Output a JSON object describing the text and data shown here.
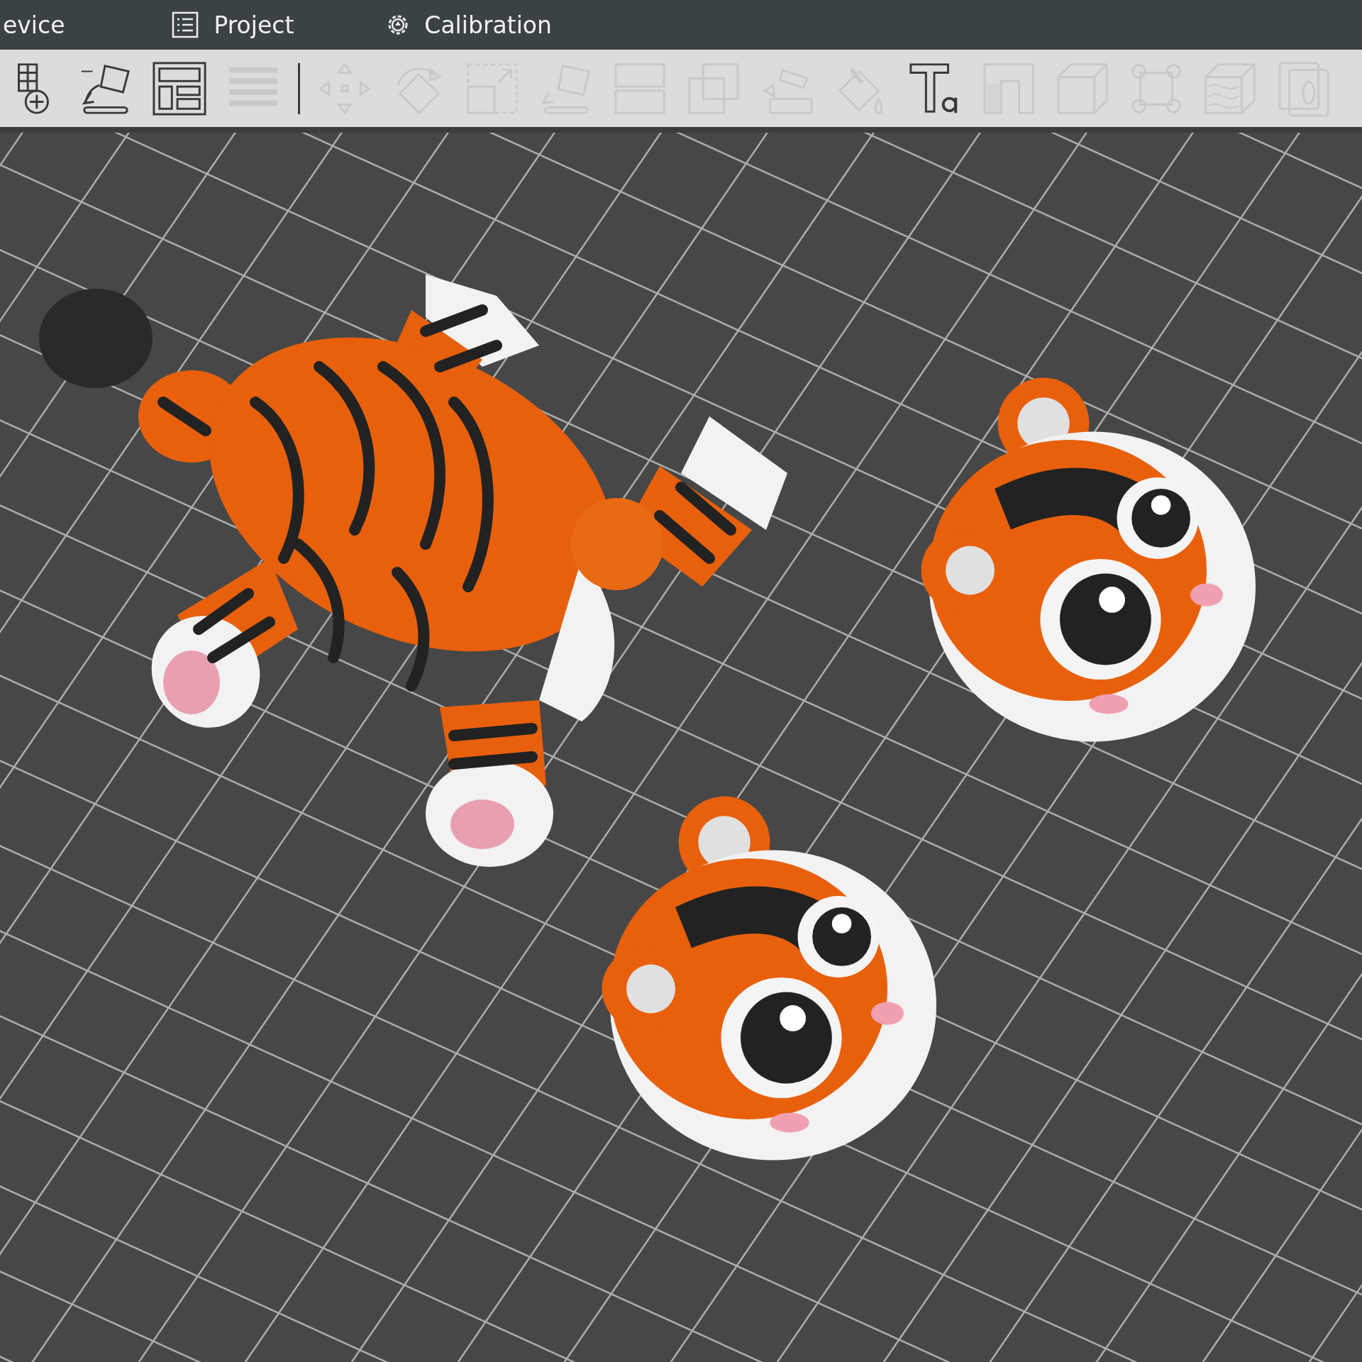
{
  "tabs": [
    {
      "label": "evice",
      "kind": "plain",
      "selected": false
    },
    {
      "label": "Project",
      "kind": "project",
      "selected": false
    },
    {
      "label": "Calibration",
      "kind": "calibration",
      "selected": false
    }
  ],
  "toolbar": [
    {
      "kind": "add-plate",
      "disabled": false
    },
    {
      "kind": "auto-orient",
      "disabled": false
    },
    {
      "kind": "arrange",
      "disabled": false
    },
    {
      "kind": "layers",
      "disabled": true
    },
    {
      "kind": "separator"
    },
    {
      "kind": "move",
      "disabled": true
    },
    {
      "kind": "rotate",
      "disabled": true
    },
    {
      "kind": "scale",
      "disabled": true
    },
    {
      "kind": "lay-on-face",
      "disabled": true
    },
    {
      "kind": "split",
      "disabled": true
    },
    {
      "kind": "boolean",
      "disabled": true
    },
    {
      "kind": "supports",
      "disabled": true
    },
    {
      "kind": "paint",
      "disabled": true
    },
    {
      "kind": "text",
      "disabled": false
    },
    {
      "kind": "measure",
      "disabled": true
    },
    {
      "kind": "cube",
      "disabled": true
    },
    {
      "kind": "assembly",
      "disabled": true
    },
    {
      "kind": "fuzzy",
      "disabled": true
    },
    {
      "kind": "copy",
      "disabled": true
    }
  ]
}
